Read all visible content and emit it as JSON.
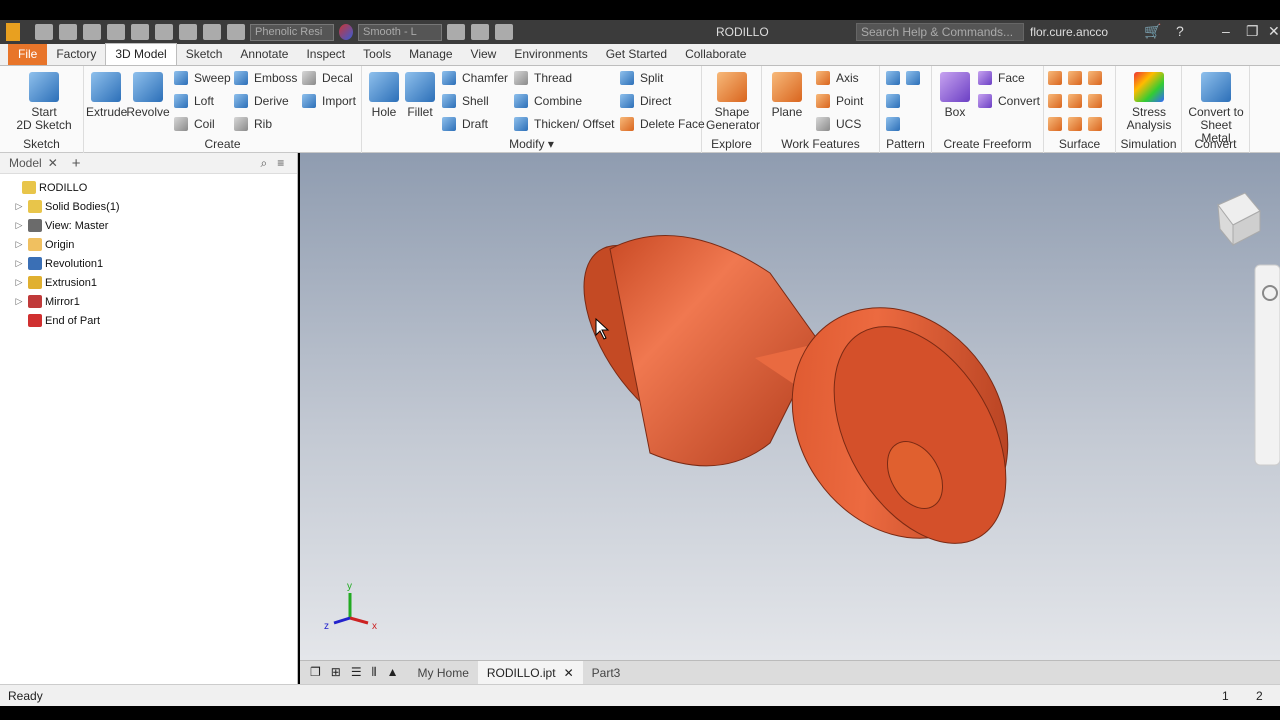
{
  "titlebar": {
    "title": "RODILLO",
    "material": "Phenolic Resi",
    "appearance": "Smooth - L",
    "search_placeholder": "Search Help & Commands...",
    "user": "flor.cure.ancco"
  },
  "menu": {
    "tabs": [
      "File",
      "Factory",
      "3D Model",
      "Sketch",
      "Annotate",
      "Inspect",
      "Tools",
      "Manage",
      "View",
      "Environments",
      "Get Started",
      "Collaborate"
    ],
    "active": "3D Model"
  },
  "ribbon": {
    "sketch": {
      "label": "Sketch",
      "start": "Start\n2D Sketch"
    },
    "create": {
      "label": "Create",
      "extrude": "Extrude",
      "revolve": "Revolve",
      "sweep": "Sweep",
      "loft": "Loft",
      "coil": "Coil",
      "emboss": "Emboss",
      "derive": "Derive",
      "rib": "Rib",
      "decal": "Decal",
      "import": "Import"
    },
    "modify": {
      "label": "Modify",
      "hole": "Hole",
      "fillet": "Fillet",
      "chamfer": "Chamfer",
      "shell": "Shell",
      "draft": "Draft",
      "thread": "Thread",
      "combine": "Combine",
      "thicken": "Thicken/ Offset",
      "split": "Split",
      "direct": "Direct",
      "delete_face": "Delete Face"
    },
    "explore": {
      "label": "Explore",
      "shape_generator": "Shape\nGenerator"
    },
    "work_features": {
      "label": "Work Features",
      "plane": "Plane",
      "axis": "Axis",
      "point": "Point",
      "ucs": "UCS"
    },
    "pattern": {
      "label": "Pattern"
    },
    "freeform": {
      "label": "Create Freeform",
      "box": "Box",
      "face": "Face",
      "convert": "Convert"
    },
    "surface": {
      "label": "Surface"
    },
    "simulation": {
      "label": "Simulation",
      "stress": "Stress\nAnalysis"
    },
    "convert": {
      "label": "Convert",
      "sheet_metal": "Convert to\nSheet Metal"
    }
  },
  "browser": {
    "header": "Model",
    "nodes": [
      {
        "label": "RODILLO",
        "color": "#e8c54a"
      },
      {
        "label": "Solid Bodies(1)",
        "color": "#e8c54a"
      },
      {
        "label": "View: Master",
        "color": "#6b6b6b"
      },
      {
        "label": "Origin",
        "color": "#f0c060"
      },
      {
        "label": "Revolution1",
        "color": "#3a6fb5"
      },
      {
        "label": "Extrusion1",
        "color": "#e0b030"
      },
      {
        "label": "Mirror1",
        "color": "#c03a3a"
      },
      {
        "label": "End of Part",
        "color": "#d03030"
      }
    ]
  },
  "viewport": {
    "model_color": "#d9532a",
    "axis_labels": {
      "x": "x",
      "y": "y",
      "z": "z"
    }
  },
  "doc_tabs": {
    "home": "My Home",
    "active": "RODILLO.ipt",
    "other": "Part3"
  },
  "status": {
    "text": "Ready",
    "n1": "1",
    "n2": "2"
  }
}
